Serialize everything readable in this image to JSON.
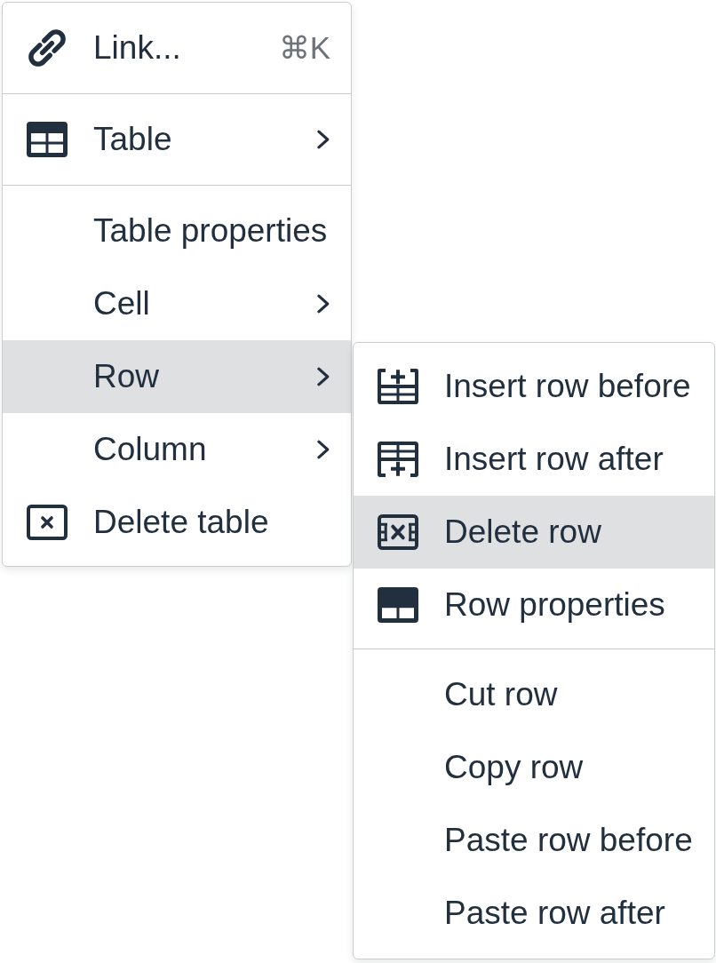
{
  "menu": {
    "sections": [
      {
        "items": [
          {
            "label": "Link...",
            "shortcut": "⌘K",
            "has_submenu": false,
            "selected": false
          }
        ]
      },
      {
        "items": [
          {
            "label": "Table",
            "has_submenu": true,
            "selected": false
          }
        ]
      },
      {
        "items": [
          {
            "label": "Table properties",
            "has_submenu": false,
            "selected": false
          },
          {
            "label": "Cell",
            "has_submenu": true,
            "selected": false
          },
          {
            "label": "Row",
            "has_submenu": true,
            "selected": true
          },
          {
            "label": "Column",
            "has_submenu": true,
            "selected": false
          },
          {
            "label": "Delete table",
            "has_submenu": false,
            "selected": false
          }
        ]
      }
    ]
  },
  "submenu": {
    "sections": [
      {
        "items": [
          {
            "label": "Insert row before",
            "selected": false
          },
          {
            "label": "Insert row after",
            "selected": false
          },
          {
            "label": "Delete row",
            "selected": true
          },
          {
            "label": "Row properties",
            "selected": false
          }
        ]
      },
      {
        "items": [
          {
            "label": "Cut row",
            "selected": false
          },
          {
            "label": "Copy row",
            "selected": false
          },
          {
            "label": "Paste row before",
            "selected": false
          },
          {
            "label": "Paste row after",
            "selected": false
          }
        ]
      }
    ]
  }
}
